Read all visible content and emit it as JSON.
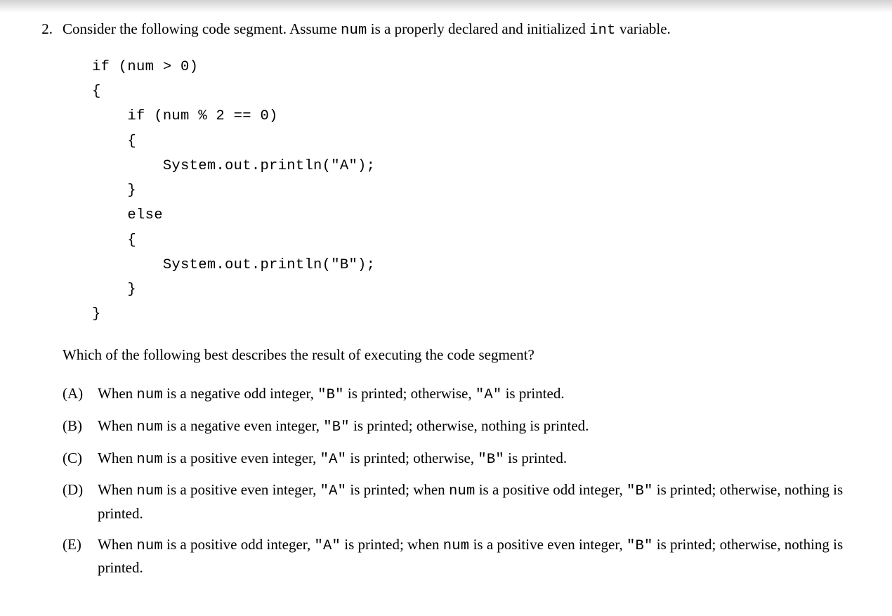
{
  "question": {
    "number": "2.",
    "stem_pre": "Consider the following code segment. Assume ",
    "stem_code1": "num",
    "stem_mid": " is a properly declared and initialized ",
    "stem_code2": "int",
    "stem_post": " variable.",
    "code": "if (num > 0)\n{\n    if (num % 2 == 0)\n    {\n        System.out.println(\"A\");\n    }\n    else\n    {\n        System.out.println(\"B\");\n    }\n}",
    "subq": "Which of the following best describes the result of executing the code segment?",
    "choices": [
      {
        "label": "(A)",
        "parts": [
          {
            "t": "text",
            "v": "When "
          },
          {
            "t": "code",
            "v": "num"
          },
          {
            "t": "text",
            "v": " is a negative odd integer, "
          },
          {
            "t": "code",
            "v": "\"B\""
          },
          {
            "t": "text",
            "v": " is printed; otherwise, "
          },
          {
            "t": "code",
            "v": "\"A\""
          },
          {
            "t": "text",
            "v": " is printed."
          }
        ]
      },
      {
        "label": "(B)",
        "parts": [
          {
            "t": "text",
            "v": "When "
          },
          {
            "t": "code",
            "v": "num"
          },
          {
            "t": "text",
            "v": " is a negative even integer, "
          },
          {
            "t": "code",
            "v": "\"B\""
          },
          {
            "t": "text",
            "v": " is printed; otherwise, nothing is printed."
          }
        ]
      },
      {
        "label": "(C)",
        "parts": [
          {
            "t": "text",
            "v": "When "
          },
          {
            "t": "code",
            "v": "num"
          },
          {
            "t": "text",
            "v": " is a positive even integer, "
          },
          {
            "t": "code",
            "v": "\"A\""
          },
          {
            "t": "text",
            "v": " is printed; otherwise, "
          },
          {
            "t": "code",
            "v": "\"B\""
          },
          {
            "t": "text",
            "v": " is printed."
          }
        ]
      },
      {
        "label": "(D)",
        "parts": [
          {
            "t": "text",
            "v": "When "
          },
          {
            "t": "code",
            "v": "num"
          },
          {
            "t": "text",
            "v": " is a positive even integer, "
          },
          {
            "t": "code",
            "v": "\"A\""
          },
          {
            "t": "text",
            "v": " is printed; when "
          },
          {
            "t": "code",
            "v": "num"
          },
          {
            "t": "text",
            "v": " is a positive odd integer, "
          },
          {
            "t": "code",
            "v": "\"B\""
          },
          {
            "t": "text",
            "v": " is printed; otherwise, nothing is printed."
          }
        ]
      },
      {
        "label": "(E)",
        "parts": [
          {
            "t": "text",
            "v": "When "
          },
          {
            "t": "code",
            "v": "num"
          },
          {
            "t": "text",
            "v": " is a positive odd integer, "
          },
          {
            "t": "code",
            "v": "\"A\""
          },
          {
            "t": "text",
            "v": " is printed; when "
          },
          {
            "t": "code",
            "v": "num"
          },
          {
            "t": "text",
            "v": " is a positive even integer, "
          },
          {
            "t": "code",
            "v": "\"B\""
          },
          {
            "t": "text",
            "v": " is printed; otherwise, nothing is printed."
          }
        ]
      }
    ]
  }
}
